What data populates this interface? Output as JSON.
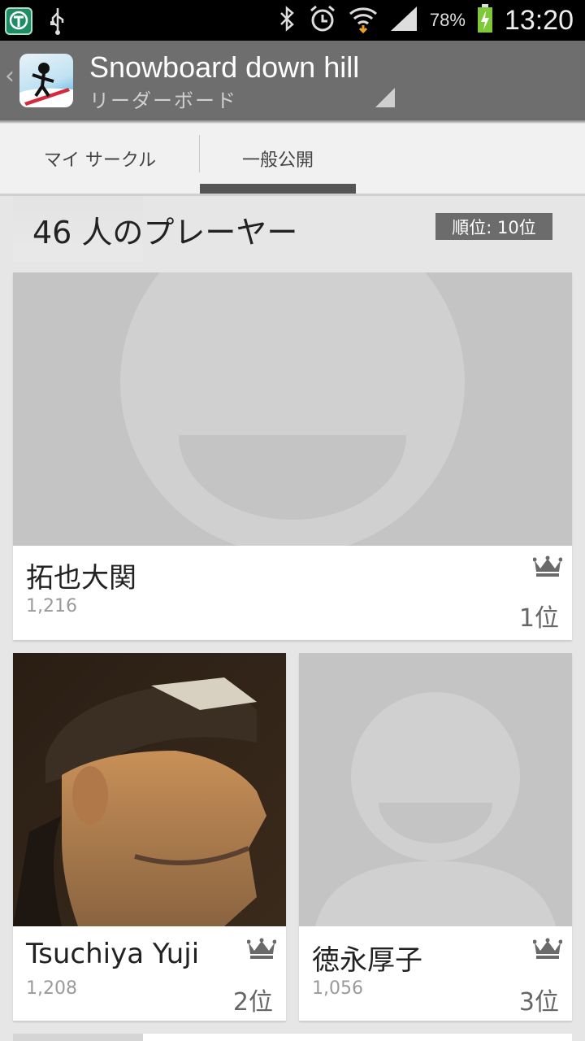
{
  "status_bar": {
    "battery_percent": "78%",
    "time": "13:20",
    "icons": [
      "shield-app-icon",
      "usb-icon",
      "bluetooth-icon",
      "alarm-icon",
      "wifi-icon",
      "signal-icon",
      "battery-charging-icon"
    ]
  },
  "app_bar": {
    "title": "Snowboard down hill",
    "subtitle": "リーダーボード"
  },
  "tabs": [
    {
      "label": "マイ サークル",
      "selected": false
    },
    {
      "label": "一般公開",
      "selected": true
    }
  ],
  "leaderboard": {
    "players_count_label": "46 人のプレーヤー",
    "my_rank_label": "順位: 10位",
    "entries": [
      {
        "name": "拓也大関",
        "score": "1,216",
        "place": "1位",
        "avatar": "default-avatar"
      },
      {
        "name": "Tsuchiya Yuji",
        "score": "1,208",
        "place": "2位",
        "avatar": "photo"
      },
      {
        "name": "徳永厚子",
        "score": "1,056",
        "place": "3位",
        "avatar": "default-avatar"
      }
    ]
  },
  "colors": {
    "app_bar": "#6e6e6e",
    "tab_indicator": "#555555",
    "rank_badge": "#6c6c6c",
    "avatar_placeholder": "#c5c5c5",
    "content_bg": "#e6e6e6"
  }
}
